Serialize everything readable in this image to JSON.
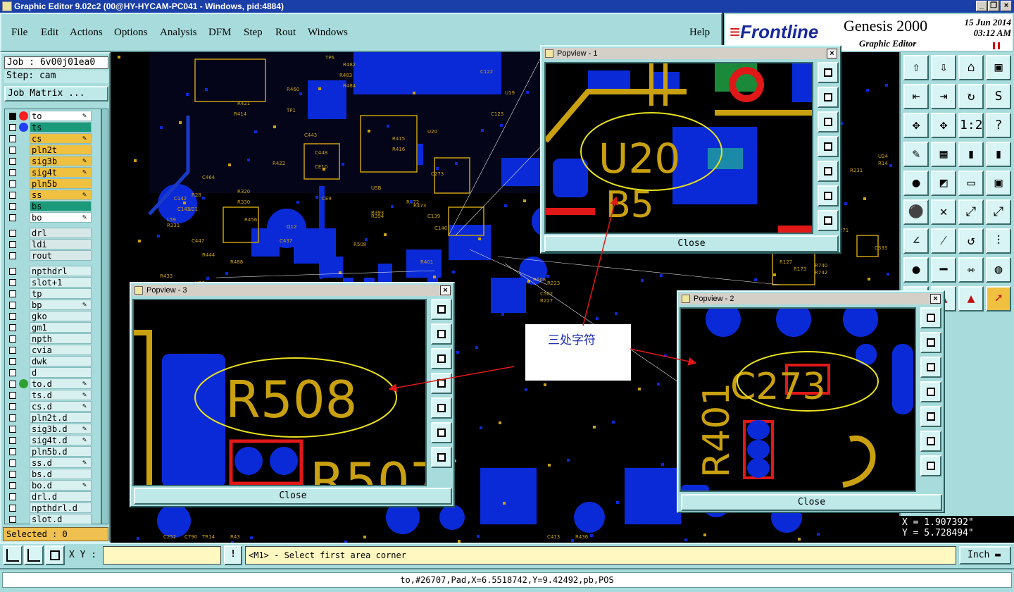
{
  "window": {
    "title": "Graphic Editor 9.02c2 (00@HY-HYCAM-PC041 - Windows, pid:4884)"
  },
  "menu": [
    "File",
    "Edit",
    "Actions",
    "Options",
    "Analysis",
    "DFM",
    "Step",
    "Rout",
    "Windows"
  ],
  "help_label": "Help",
  "brand": {
    "logo": "Frontline",
    "product": "Genesis 2000",
    "subtitle": "Graphic Editor",
    "date": "15 Jun 2014",
    "time": "03:12 AM"
  },
  "job": {
    "job_label": "Job : 6v00j01ea0",
    "step_label": "Step: cam",
    "job_matrix_label": "Job Matrix ..."
  },
  "layers": [
    {
      "name": "to",
      "color": "#ffffff",
      "dot": "#ff2020",
      "icon": "✎"
    },
    {
      "name": "ts",
      "color": "#1a9a7a",
      "dot": "#2040ff",
      "icon": ""
    },
    {
      "name": "cs",
      "color": "#f0c040",
      "dot": "",
      "icon": "✎"
    },
    {
      "name": "pln2t",
      "color": "#f0c040",
      "dot": "",
      "icon": ""
    },
    {
      "name": "sig3b",
      "color": "#f0c040",
      "dot": "",
      "icon": "✎"
    },
    {
      "name": "sig4t",
      "color": "#f0c040",
      "dot": "",
      "icon": "✎"
    },
    {
      "name": "pln5b",
      "color": "#f0c040",
      "dot": "",
      "icon": ""
    },
    {
      "name": "ss",
      "color": "#f0c040",
      "dot": "",
      "icon": "✎"
    },
    {
      "name": "bs",
      "color": "#1a9a7a",
      "dot": "",
      "icon": ""
    },
    {
      "name": "bo",
      "color": "#ffffff",
      "dot": "",
      "icon": "✎"
    },
    {
      "name": "drl",
      "color": "#d8e8e8",
      "dot": "",
      "icon": ""
    },
    {
      "name": "ldi",
      "color": "#d8e8e8",
      "dot": "",
      "icon": ""
    },
    {
      "name": "rout",
      "color": "#d8e8e8",
      "dot": "",
      "icon": ""
    },
    {
      "name": "npthdrl",
      "color": "#d8f0f0",
      "dot": "",
      "icon": ""
    },
    {
      "name": "slot+1",
      "color": "#d8f0f0",
      "dot": "",
      "icon": ""
    },
    {
      "name": "tp",
      "color": "#d8f0f0",
      "dot": "",
      "icon": ""
    },
    {
      "name": "bp",
      "color": "#d8f0f0",
      "dot": "",
      "icon": "✎"
    },
    {
      "name": "gko",
      "color": "#d8f0f0",
      "dot": "",
      "icon": ""
    },
    {
      "name": "gm1",
      "color": "#d8f0f0",
      "dot": "",
      "icon": ""
    },
    {
      "name": "npth",
      "color": "#d8f0f0",
      "dot": "",
      "icon": ""
    },
    {
      "name": "cvia",
      "color": "#d8f0f0",
      "dot": "",
      "icon": ""
    },
    {
      "name": "dwk",
      "color": "#d8f0f0",
      "dot": "",
      "icon": ""
    },
    {
      "name": "d",
      "color": "#d8f0f0",
      "dot": "",
      "icon": ""
    },
    {
      "name": "to.d",
      "color": "#d8f0f0",
      "dot": "#30a030",
      "icon": "✎"
    },
    {
      "name": "ts.d",
      "color": "#d8f0f0",
      "dot": "",
      "icon": "✎"
    },
    {
      "name": "cs.d",
      "color": "#d8f0f0",
      "dot": "",
      "icon": "✎"
    },
    {
      "name": "pln2t.d",
      "color": "#d8f0f0",
      "dot": "",
      "icon": ""
    },
    {
      "name": "sig3b.d",
      "color": "#d8f0f0",
      "dot": "",
      "icon": "✎"
    },
    {
      "name": "sig4t.d",
      "color": "#d8f0f0",
      "dot": "",
      "icon": "✎"
    },
    {
      "name": "pln5b.d",
      "color": "#d8f0f0",
      "dot": "",
      "icon": ""
    },
    {
      "name": "ss.d",
      "color": "#d8f0f0",
      "dot": "",
      "icon": "✎"
    },
    {
      "name": "bs.d",
      "color": "#d8f0f0",
      "dot": "",
      "icon": ""
    },
    {
      "name": "bo.d",
      "color": "#d8f0f0",
      "dot": "",
      "icon": "✎"
    },
    {
      "name": "drl.d",
      "color": "#d8f0f0",
      "dot": "",
      "icon": ""
    },
    {
      "name": "npthdrl.d",
      "color": "#d8f0f0",
      "dot": "",
      "icon": ""
    },
    {
      "name": "slot.d",
      "color": "#d8f0f0",
      "dot": "",
      "icon": ""
    }
  ],
  "selected_label": "Selected : 0",
  "popviews": [
    {
      "title": "Popview - 1",
      "label": "U20",
      "label2": "B5",
      "close": "Close"
    },
    {
      "title": "Popview - 2",
      "label": "C273",
      "label2": "R401",
      "close": "Close"
    },
    {
      "title": "Popview - 3",
      "label": "R508",
      "label2": "R507",
      "close": "Close"
    }
  ],
  "callout": "三处字符",
  "coords": {
    "x": "X = 1.907392\"",
    "y": "Y = 5.728494\""
  },
  "bottom": {
    "xy_label": "X Y :",
    "xy_value": "",
    "prompt": "<M1> - Select first area corner",
    "units": "Inch"
  },
  "status": "to,#26707,Pad,X=6.5518742,Y=9.42492,pb,POS",
  "canvas_labels": [
    "R508",
    "U20",
    "C273",
    "USB",
    "CE10",
    "CE9",
    "R473",
    "R472",
    "C464",
    "R401",
    "R488",
    "C447",
    "R456",
    "R460",
    "C443",
    "C448",
    "R422",
    "R421",
    "R414",
    "TP1",
    "R482",
    "R483",
    "R484",
    "TP6",
    "C142",
    "C143",
    "L59",
    "U21",
    "R28",
    "R320",
    "R330",
    "R331",
    "C437",
    "Q12",
    "R444",
    "U33",
    "R433",
    "R435",
    "R393",
    "R394",
    "C139",
    "C140",
    "R415",
    "R416",
    "C122",
    "C123",
    "R127",
    "R173",
    "R740",
    "R742",
    "C271",
    "R231",
    "U24",
    "R14",
    "C333",
    "U19",
    "TR14",
    "R43",
    "C252",
    "C790",
    "R436",
    "C413",
    "R608",
    "C502",
    "R227",
    "R223"
  ]
}
